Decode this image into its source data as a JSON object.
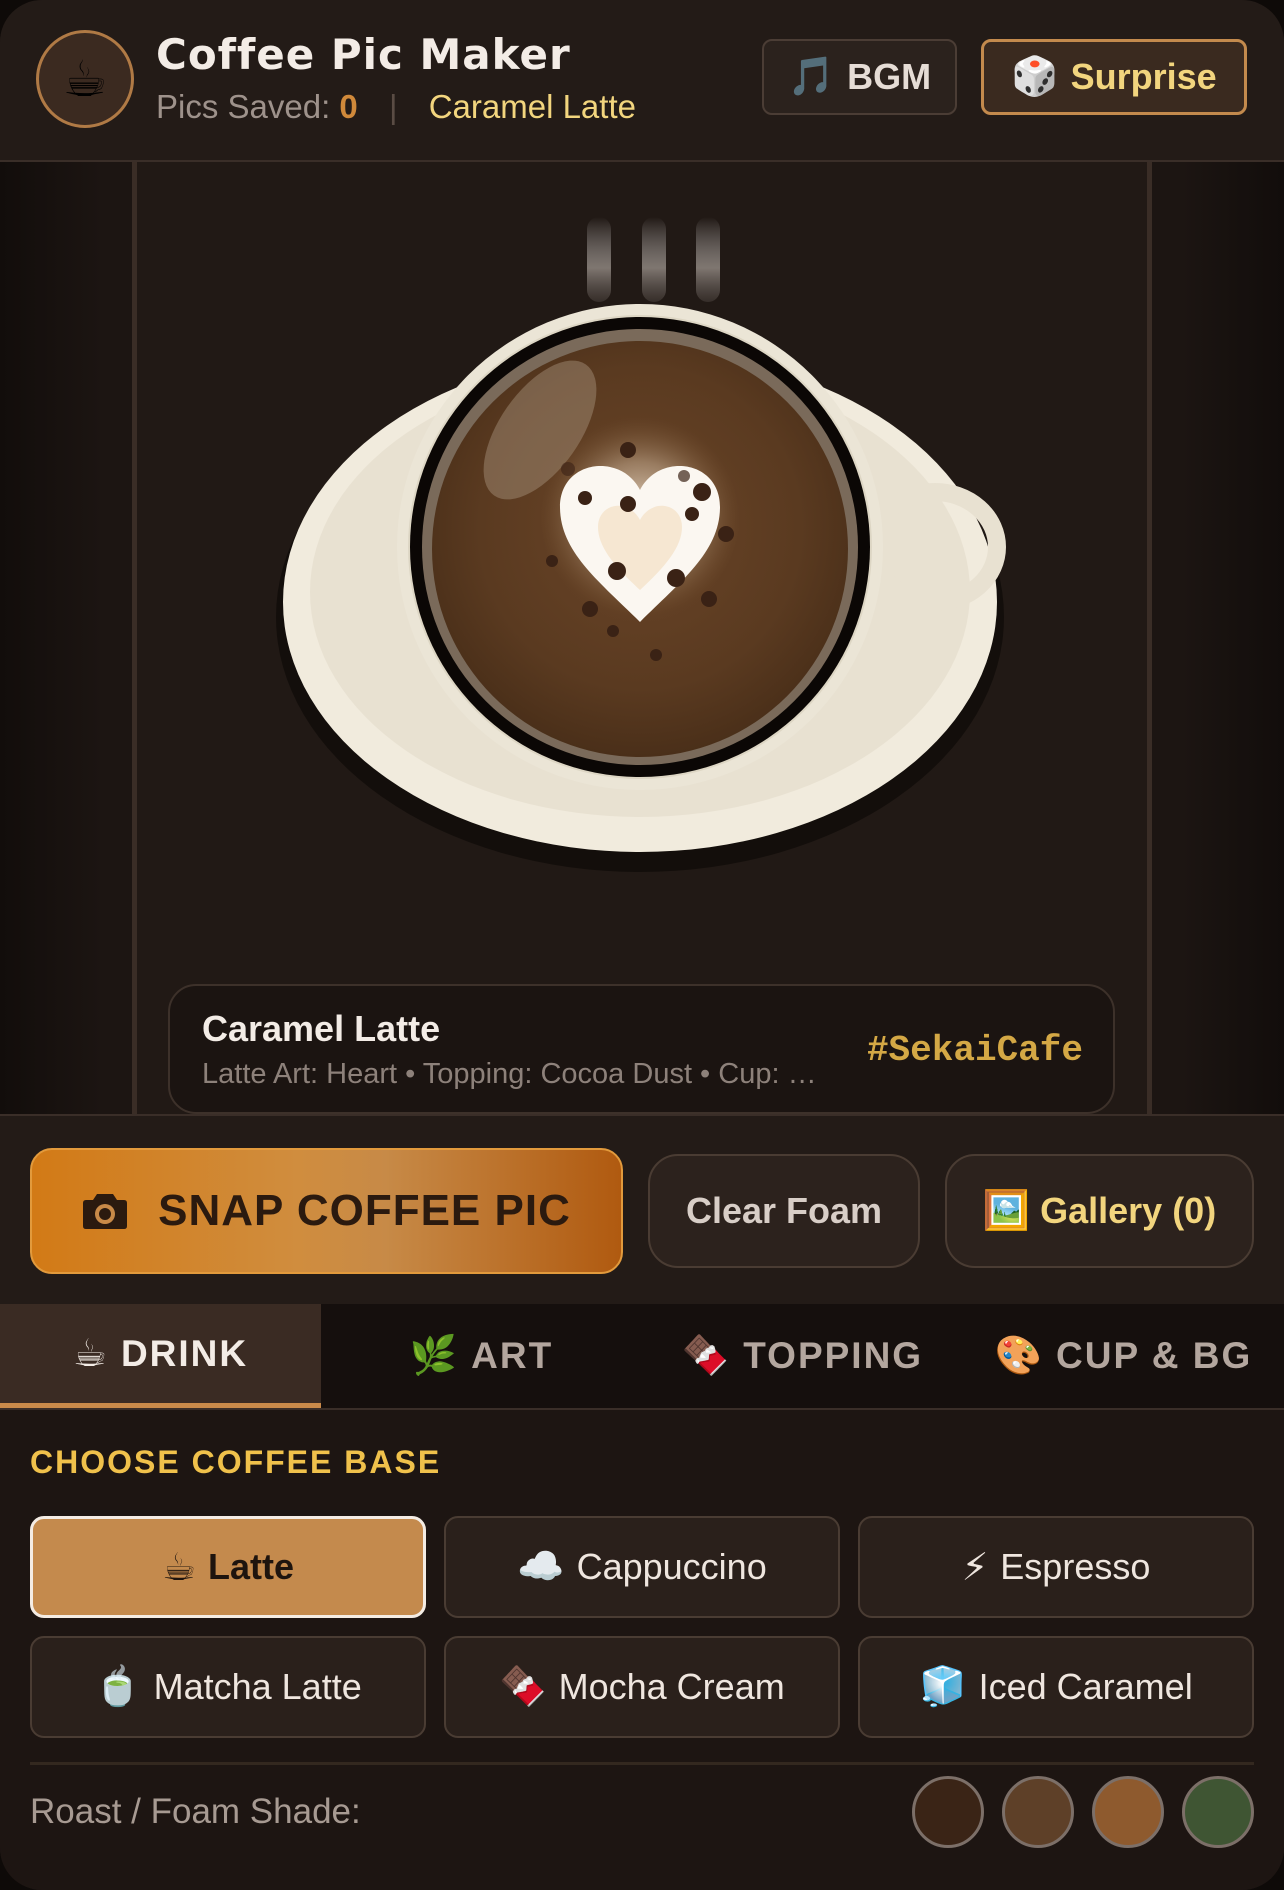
{
  "header": {
    "logo_icon": "☕",
    "title": "Coffee Pic Maker",
    "pics_saved_label": "Pics Saved:",
    "pics_saved_count": "0",
    "separator": "|",
    "current_drink": "Caramel Latte",
    "bgm": {
      "icon": "🎵",
      "label": "BGM"
    },
    "surprise": {
      "icon": "🎲",
      "label": "Surprise"
    }
  },
  "caption": {
    "title": "Caramel Latte",
    "detail": "Latte Art: Heart • Topping: Cocoa Dust • Cup: …",
    "hashtag": "#SekaiCafe"
  },
  "actions": {
    "snap": {
      "icon": "camera-icon",
      "label": "SNAP COFFEE PIC"
    },
    "clear": {
      "label": "Clear Foam"
    },
    "gallery": {
      "icon": "🖼️",
      "label": "Gallery (0)"
    }
  },
  "tabs": [
    {
      "icon": "☕",
      "label": "DRINK",
      "active": true
    },
    {
      "icon": "🌿",
      "label": "ART",
      "active": false
    },
    {
      "icon": "🍫",
      "label": "TOPPING",
      "active": false
    },
    {
      "icon": "🎨",
      "label": "CUP & BG",
      "active": false
    }
  ],
  "panel": {
    "section_title": "CHOOSE COFFEE BASE",
    "options": [
      {
        "icon": "☕",
        "label": "Latte",
        "selected": true
      },
      {
        "icon": "☁️",
        "label": "Cappuccino",
        "selected": false
      },
      {
        "icon": "⚡",
        "label": "Espresso",
        "selected": false
      },
      {
        "icon": "🍵",
        "label": "Matcha Latte",
        "selected": false
      },
      {
        "icon": "🍫",
        "label": "Mocha Cream",
        "selected": false
      },
      {
        "icon": "🧊",
        "label": "Iced Caramel",
        "selected": false
      }
    ],
    "shade_label": "Roast / Foam Shade:",
    "shades": [
      "#3a2416",
      "#5e4028",
      "#8e5a2e",
      "#3f5533"
    ]
  },
  "colors": {
    "accent": "#c98a4a",
    "highlight": "#f2d57e",
    "background": "#1d1512"
  }
}
